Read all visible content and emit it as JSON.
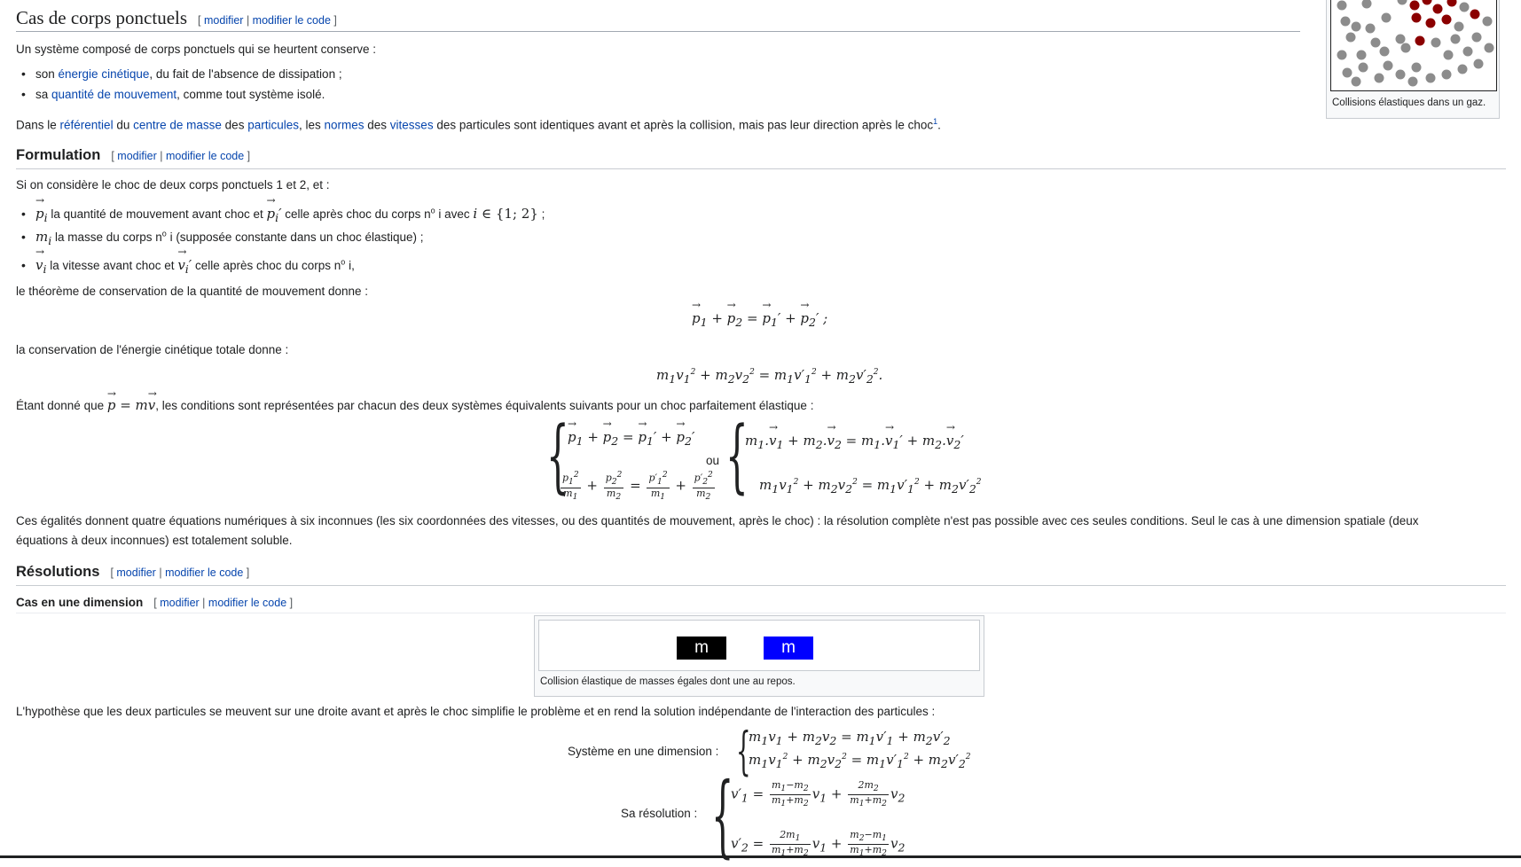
{
  "section_main": {
    "title": "Cas de corps ponctuels",
    "edit": "modifier",
    "edit_code": "modifier le code"
  },
  "intro": "Un système composé de corps ponctuels qui se heurtent conserve :",
  "bullets1": [
    {
      "pre": "son ",
      "link": "énergie cinétique",
      "post": ", du fait de l'absence de dissipation ;"
    },
    {
      "pre": "sa ",
      "link": "quantité de mouvement",
      "post": ", comme tout système isolé."
    }
  ],
  "frame_para": {
    "t1": "Dans le ",
    "l1": "référentiel",
    "t2": " du ",
    "l2": "centre de masse",
    "t3": " des ",
    "l3": "particules",
    "t4": ", les ",
    "l4": "normes",
    "t5": " des ",
    "l5": "vitesses",
    "t6": " des particules sont identiques avant et après la collision, mais pas leur direction après le choc",
    "ref": "1",
    "t7": "."
  },
  "thumb_gas": {
    "caption": "Collisions élastiques dans un gaz."
  },
  "formulation": {
    "title": "Formulation",
    "edit": "modifier",
    "edit_code": "modifier le code"
  },
  "form_intro": "Si on considère le choc de deux corps ponctuels 1 et 2, et :",
  "form_items": [
    {
      "a": " la quantité de mouvement avant choc et ",
      "b": " celle après choc du corps n",
      "c": "o",
      "d": " i avec ",
      "e": " ;"
    },
    {
      "a": " la masse du corps n",
      "c": "o",
      "d": " i (supposée constante dans un choc élastique) ;"
    },
    {
      "a": " la vitesse avant choc et ",
      "b": " celle après choc du corps n",
      "c": "o",
      "d": " i,"
    }
  ],
  "theorem": "le théorème de conservation de la quantité de mouvement donne :",
  "kinetic": "la conservation de l'énergie cinétique totale donne :",
  "given": {
    "pre": "Étant donné que ",
    "post": ", les conditions sont représentées par chacun des deux systèmes équivalents suivants pour un choc parfaitement élastique :"
  },
  "or_label": "ou",
  "equalities": "Ces égalités donnent quatre équations numériques à six inconnues (les six coordonnées des vitesses, ou des quantités de mouvement, après le choc) : la résolution complète n'est pas possible avec ces seules conditions. Seul le cas à une dimension spatiale (deux",
  "equalities2": "équations à deux inconnues) est totalement soluble.",
  "resolutions": {
    "title": "Résolutions",
    "edit": "modifier",
    "edit_code": "modifier le code"
  },
  "one_dim": {
    "title": "Cas en une dimension",
    "edit": "modifier",
    "edit_code": "modifier le code"
  },
  "thumb_mass": {
    "block_label": "m",
    "caption": "Collision élastique de masses égales dont une au repos.",
    "left_color": "#000000",
    "right_color": "#0000ff"
  },
  "hypothesis": "L'hypothèse que les deux particules se meuvent sur une droite avant et après le choc simplifie le problème et en rend la solution indépendante de l'interaction des particules :",
  "system_label": "Système en une dimension :",
  "resolution_label": "Sa résolution :"
}
